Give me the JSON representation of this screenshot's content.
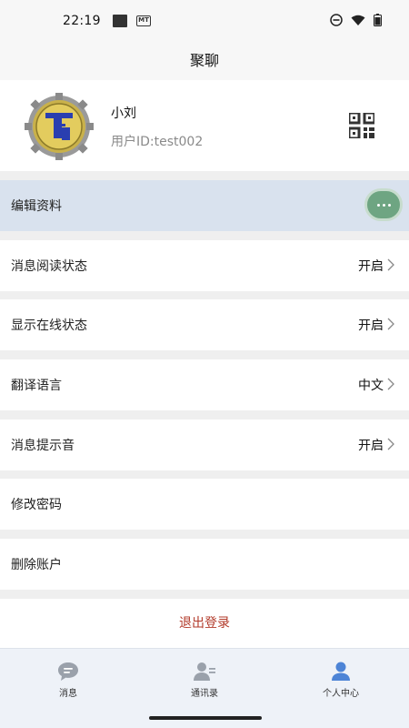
{
  "status": {
    "time": "22:19",
    "mt_badge": "MT"
  },
  "header": {
    "title": "聚聊"
  },
  "profile": {
    "name": "小刘",
    "user_id": "用户ID:test002"
  },
  "menu": [
    {
      "label": "编辑资料",
      "value": ""
    },
    {
      "label": "消息阅读状态",
      "value": "开启"
    },
    {
      "label": "显示在线状态",
      "value": "开启"
    },
    {
      "label": "翻译语言",
      "value": "中文"
    },
    {
      "label": "消息提示音",
      "value": "开启"
    },
    {
      "label": "修改密码",
      "value": ""
    },
    {
      "label": "删除账户",
      "value": ""
    }
  ],
  "logout_label": "退出登录",
  "tabs": [
    {
      "label": "消息",
      "icon": "chat-icon"
    },
    {
      "label": "通讯录",
      "icon": "contacts-icon"
    },
    {
      "label": "个人中心",
      "icon": "person-icon"
    }
  ],
  "colors": {
    "active_tab": "#4d84d6",
    "logout": "#b23a2a",
    "edit_row_bg": "#d9e2ee",
    "float_button": "#6ea582"
  }
}
